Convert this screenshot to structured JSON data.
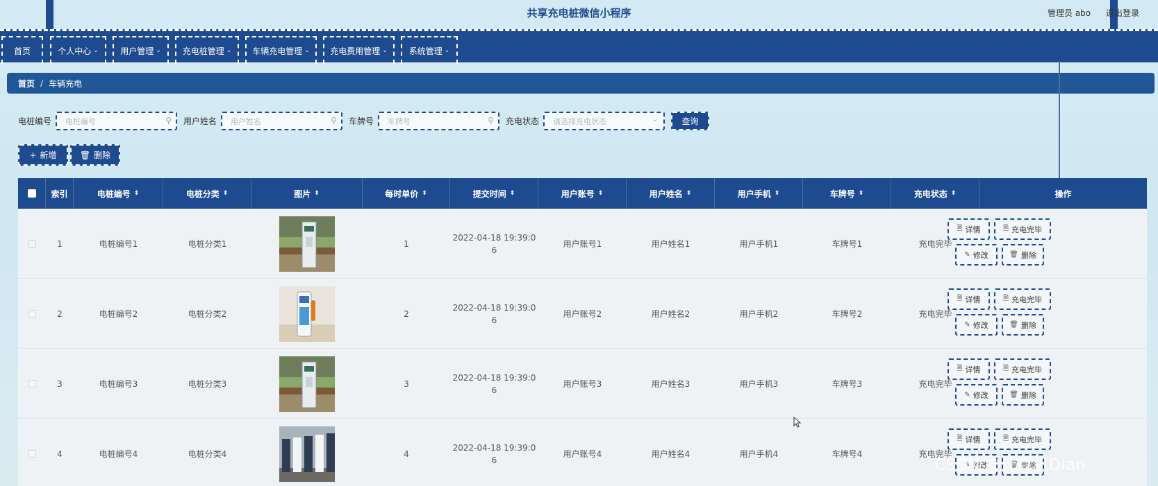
{
  "header": {
    "app_title": "共享充电桩微信小程序",
    "admin_label": "管理员 abo",
    "logout_label": "退出登录"
  },
  "nav": {
    "items": [
      {
        "label": "首页",
        "has_dropdown": false
      },
      {
        "label": "个人中心",
        "has_dropdown": true
      },
      {
        "label": "用户管理",
        "has_dropdown": true
      },
      {
        "label": "充电桩管理",
        "has_dropdown": true
      },
      {
        "label": "车辆充电管理",
        "has_dropdown": true
      },
      {
        "label": "充电费用管理",
        "has_dropdown": true
      },
      {
        "label": "系统管理",
        "has_dropdown": true
      }
    ]
  },
  "breadcrumb": {
    "home": "首页",
    "separator": "/",
    "current": "车辆充电"
  },
  "search": {
    "pile_no_label": "电桩编号",
    "pile_no_placeholder": "电桩编号",
    "user_name_label": "用户姓名",
    "user_name_placeholder": "用户姓名",
    "plate_label": "车牌号",
    "plate_placeholder": "车牌号",
    "status_label": "充电状态",
    "status_placeholder": "请选择充电状态",
    "query_button": "查询"
  },
  "actions": {
    "add_label": "新增",
    "delete_label": "删除"
  },
  "table": {
    "columns": [
      "索引",
      "电桩编号",
      "电桩分类",
      "图片",
      "每时单价",
      "提交时间",
      "用户账号",
      "用户姓名",
      "用户手机",
      "车牌号",
      "充电状态",
      "操作"
    ],
    "rows": [
      {
        "index": "1",
        "pile_no": "电桩编号1",
        "category": "电桩分类1",
        "image": "charger-outdoor",
        "price": "1",
        "submit_time": "2022-04-18 19:39:0",
        "submit_time_wrap": "6",
        "account": "用户账号1",
        "name": "用户姓名1",
        "phone": "用户手机1",
        "plate": "车牌号1",
        "status": "充电完毕"
      },
      {
        "index": "2",
        "pile_no": "电桩编号2",
        "category": "电桩分类2",
        "image": "charger-kiosk",
        "price": "2",
        "submit_time": "2022-04-18 19:39:0",
        "submit_time_wrap": "6",
        "account": "用户账号2",
        "name": "用户姓名2",
        "phone": "用户手机2",
        "plate": "车牌号2",
        "status": "充电完毕"
      },
      {
        "index": "3",
        "pile_no": "电桩编号3",
        "category": "电桩分类3",
        "image": "charger-outdoor",
        "price": "3",
        "submit_time": "2022-04-18 19:39:0",
        "submit_time_wrap": "6",
        "account": "用户账号3",
        "name": "用户姓名3",
        "phone": "用户手机3",
        "plate": "车牌号3",
        "status": "充电完毕"
      },
      {
        "index": "4",
        "pile_no": "电桩编号4",
        "category": "电桩分类4",
        "image": "charger-row",
        "price": "4",
        "submit_time": "2022-04-18 19:39:0",
        "submit_time_wrap": "6",
        "account": "用户账号4",
        "name": "用户姓名4",
        "phone": "用户手机4",
        "plate": "车牌号4",
        "status": "充电完毕"
      }
    ],
    "op_buttons": {
      "detail": "详情",
      "complete": "充电完毕",
      "edit": "修改",
      "delete": "删除"
    }
  },
  "watermark": "CSDN @计算机Dian",
  "colors": {
    "primary": "#1e4b8f",
    "breadcrumb": "#215796",
    "background": "#d6edf5",
    "row": "#eef2f4"
  }
}
